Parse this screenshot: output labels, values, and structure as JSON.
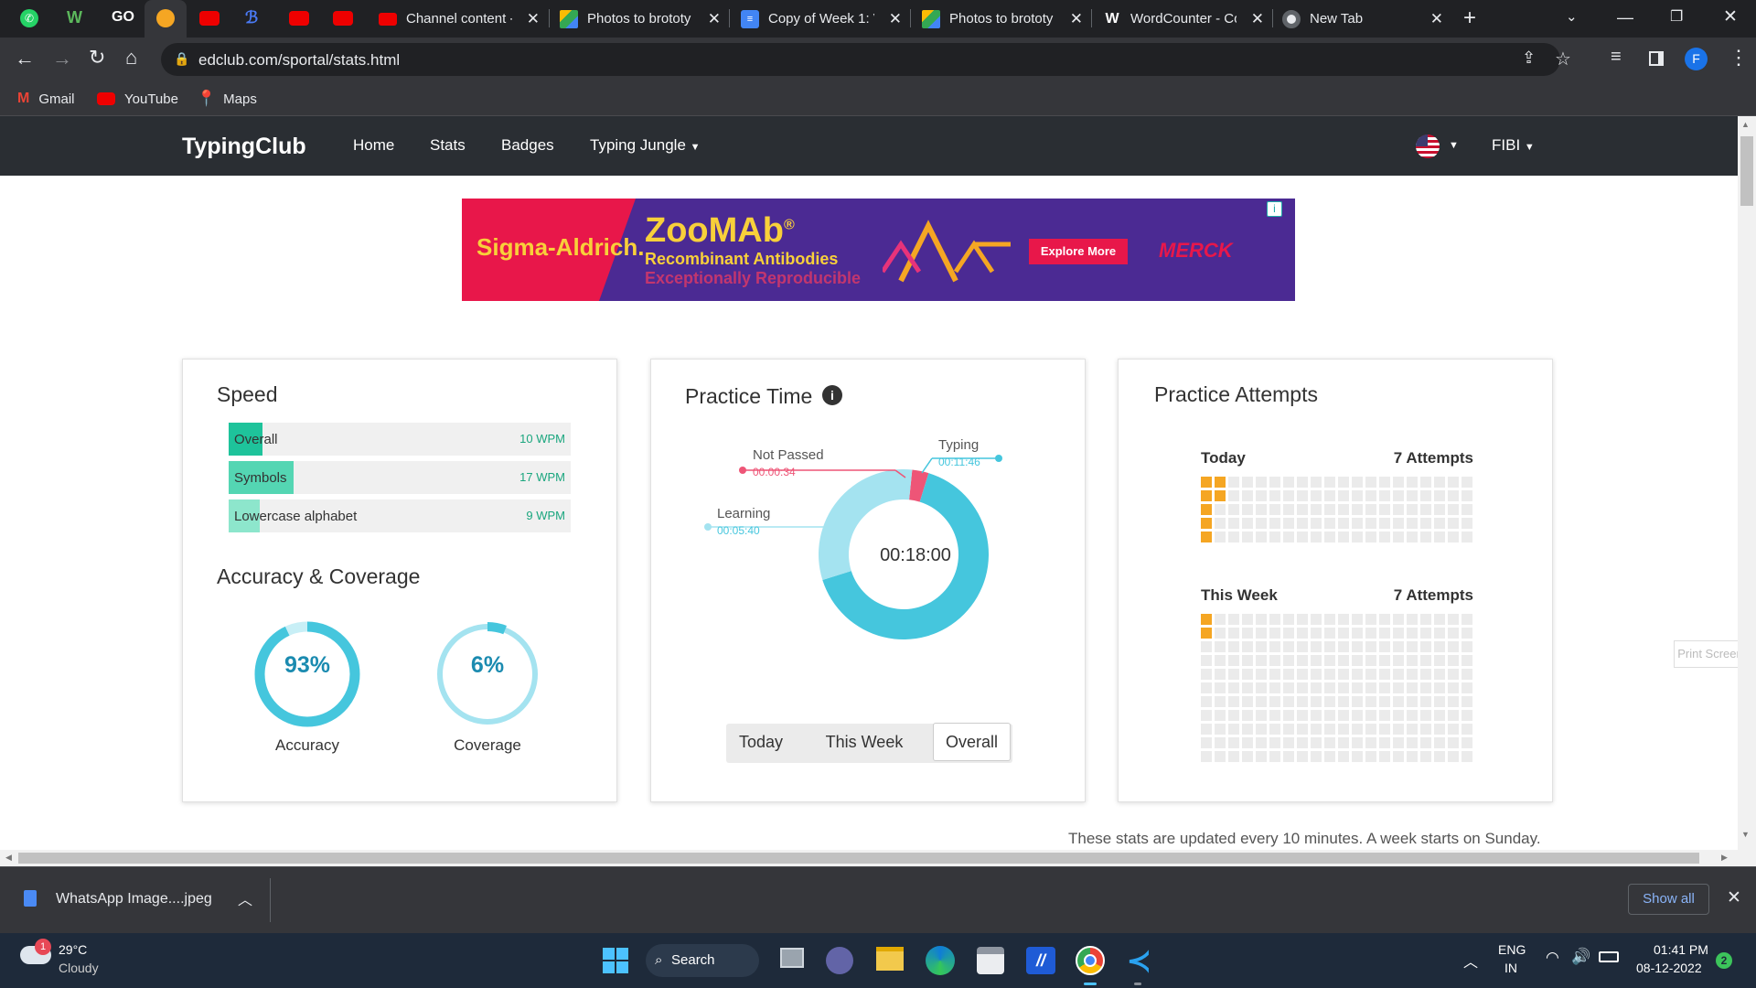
{
  "browser": {
    "tabs": [
      {
        "label": "Channel content - ",
        "icon": "youtube-icon"
      },
      {
        "label": "Photos to brototy",
        "icon": "drive-icon"
      },
      {
        "label": "Copy of Week 1: V",
        "icon": "docs-icon"
      },
      {
        "label": "Photos to brototy",
        "icon": "drive-icon"
      },
      {
        "label": "WordCounter - Co",
        "icon": "w-icon"
      },
      {
        "label": "New Tab",
        "icon": "chrome-icon"
      }
    ],
    "url": "edclub.com/sportal/stats.html",
    "profile_initial": "F",
    "bookmarks": [
      "Gmail",
      "YouTube",
      "Maps"
    ]
  },
  "site": {
    "brand": "TypingClub",
    "nav": [
      "Home",
      "Stats",
      "Badges",
      "Typing Jungle"
    ],
    "user": "FIBI"
  },
  "ad": {
    "brand": "Sigma-Aldrich.",
    "product": "ZooMAb",
    "registered": "®",
    "tagline1": "Recombinant Antibodies",
    "tagline2": "Exceptionally Reproducible",
    "cta": "Explore More",
    "sponsor": "MERCK"
  },
  "speed": {
    "title": "Speed",
    "rows": [
      {
        "label": "Overall",
        "value": "10 WPM",
        "level": 0.1
      },
      {
        "label": "Symbols",
        "value": "17 WPM",
        "level": 0.19
      },
      {
        "label": "Lowercase alphabet",
        "value": "9 WPM",
        "level": 0.09
      }
    ]
  },
  "accuracy_coverage": {
    "title": "Accuracy & Coverage",
    "accuracy": {
      "value": "93%",
      "label": "Accuracy",
      "fraction": 0.93
    },
    "coverage": {
      "value": "6%",
      "label": "Coverage",
      "fraction": 0.06
    }
  },
  "practice_time": {
    "title": "Practice Time",
    "total": "00:18:00",
    "segments": [
      {
        "name": "Typing",
        "time": "00:11:46",
        "seconds": 706,
        "color": "#45c6dd"
      },
      {
        "name": "Learning",
        "time": "00:05:40",
        "seconds": 340,
        "color": "#a4e3f0"
      },
      {
        "name": "Not Passed",
        "time": "00:00:34",
        "seconds": 34,
        "color": "#ee5577"
      }
    ],
    "filters": [
      "Today",
      "This Week",
      "Overall"
    ],
    "active_filter": "Overall"
  },
  "practice_attempts": {
    "title": "Practice Attempts",
    "today": {
      "label": "Today",
      "count": "7 Attempts"
    },
    "week": {
      "label": "This Week",
      "count": "7 Attempts"
    }
  },
  "footnote": "These stats are updated every 10 minutes. A week starts on Sunday.",
  "side_button": "Print Screen",
  "downloads": {
    "file": "WhatsApp Image....jpeg",
    "show_all": "Show all"
  },
  "taskbar": {
    "weather_temp": "29°C",
    "weather_desc": "Cloudy",
    "weather_badge": "1",
    "search": "Search",
    "lang1": "ENG",
    "lang2": "IN",
    "time": "01:41 PM",
    "date": "08-12-2022",
    "notif": "2"
  }
}
